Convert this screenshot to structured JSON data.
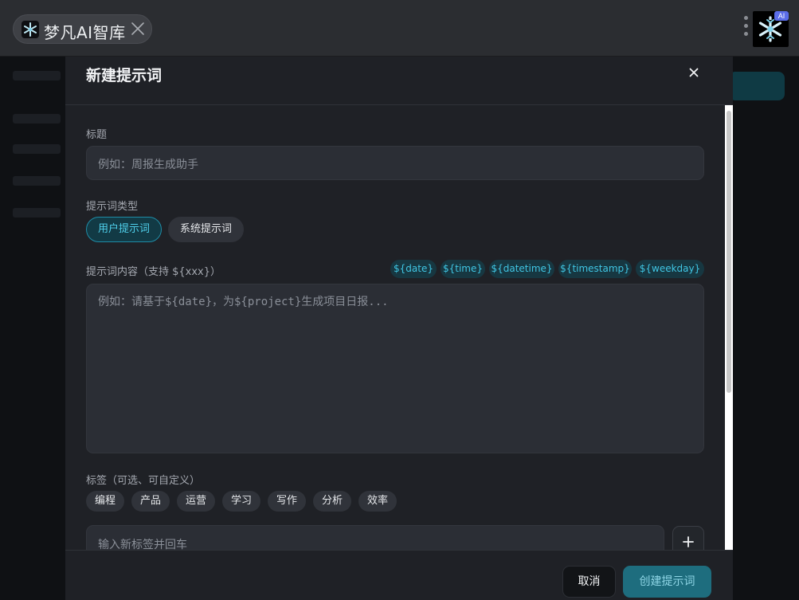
{
  "window": {
    "tab_title": "梦凡AI智库",
    "tab_logo_icon": "snowflake-logo-icon",
    "close_icon": "close-icon",
    "menu_icon": "kebab-menu-icon",
    "extension_badge": "AI",
    "extension_logo_icon": "snowflake-logo-icon"
  },
  "modal": {
    "title": "新建提示词",
    "title_field": {
      "label": "标题",
      "placeholder": "例如：周报生成助手",
      "value": ""
    },
    "type": {
      "label": "提示词类型",
      "options": [
        "用户提示词",
        "系统提示词"
      ],
      "selected": "用户提示词"
    },
    "content": {
      "label": "提示词内容（支持 ${xxx}）",
      "variables": [
        "${date}",
        "${time}",
        "${datetime}",
        "${timestamp}",
        "${weekday}"
      ],
      "placeholder": "例如：请基于${date}，为${project}生成项目日报...",
      "value": ""
    },
    "tags": {
      "label": "标签（可选、可自定义）",
      "items": [
        "编程",
        "产品",
        "运营",
        "学习",
        "写作",
        "分析",
        "效率"
      ],
      "input_placeholder": "输入新标签并回车",
      "add_icon": "plus-icon"
    },
    "footer": {
      "cancel_label": "取消",
      "create_label": "创建提示词"
    }
  },
  "colors": {
    "accent": "#4fd0ec",
    "primary_button": "#1e6d7e",
    "modal_bg": "#1f2126",
    "field_bg": "#2b2e35"
  }
}
